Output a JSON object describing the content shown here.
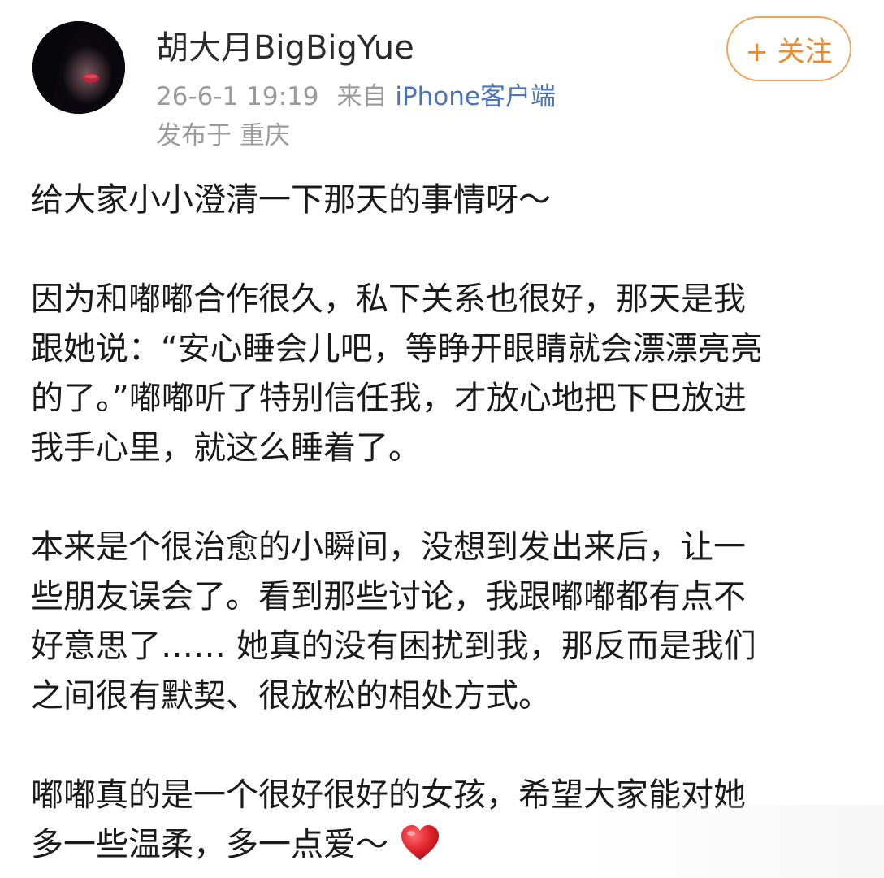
{
  "header": {
    "username": "胡大月BigBigYue",
    "timestamp": "26-6-1 19:19",
    "source_prefix": "来自",
    "source_client": "iPhone客户端",
    "location": "发布于 重庆",
    "follow_label": "+ 关注"
  },
  "post": {
    "paragraphs": [
      [
        "给大家小小澄清一下那天的事情呀～"
      ],
      [
        "因为和嘟嘟合作很久，私下关系也很好，那天是我",
        "跟她说：“安心睡会儿吧，等睁开眼睛就会漂漂亮亮",
        "的了。”嘟嘟听了特别信任我，才放心地把下巴放进",
        "我手心里，就这么睡着了。"
      ],
      [
        "本来是个很治愈的小瞬间，没想到发出来后，让一",
        "些朋友误会了。看到那些讨论，我跟嘟嘟都有点不",
        "好意思了…… 她真的没有困扰到我，那反而是我们",
        "之间很有默契、很放松的相处方式。"
      ],
      [
        "嘟嘟真的是一个很好很好的女孩，希望大家能对她",
        "多一些温柔，多一点爱～"
      ]
    ]
  },
  "icons": {
    "avatar": "avatar",
    "heart": "red-heart-emoji"
  },
  "colors": {
    "accent_orange": "#ec8a2c",
    "link_blue": "#4a73b8",
    "meta_gray": "#9a9a9a",
    "heart_red": "#e0242c"
  }
}
